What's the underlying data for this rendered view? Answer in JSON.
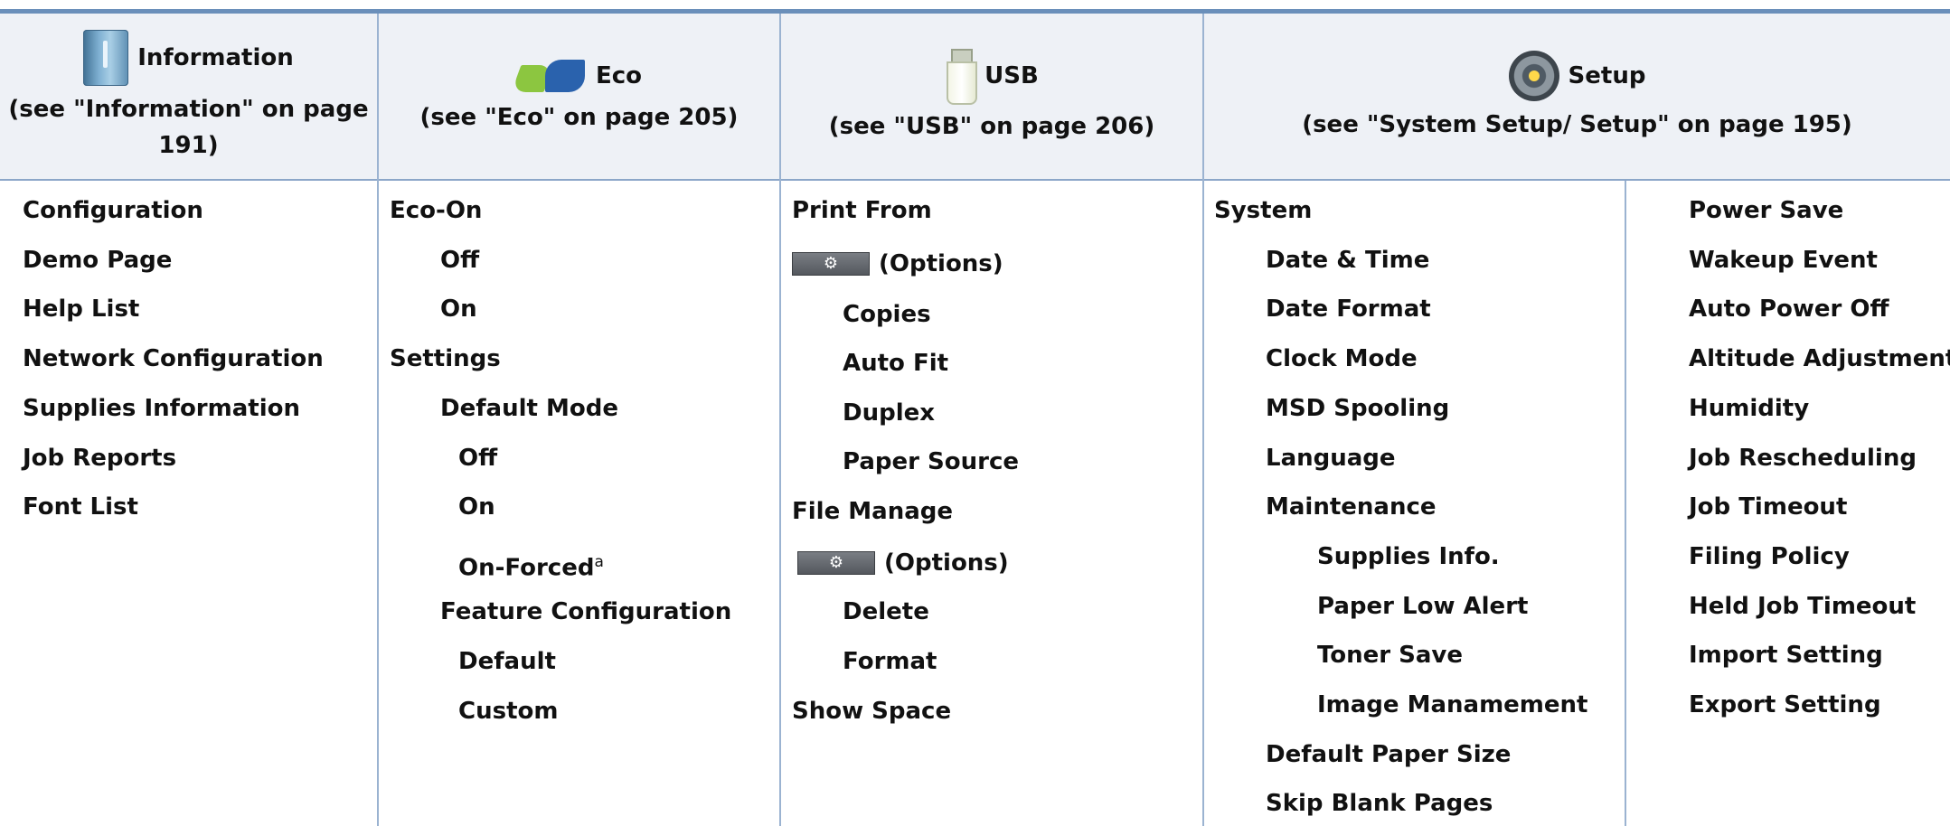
{
  "headers": {
    "information": {
      "title": "Information",
      "ref": "(see \"Information\" on page",
      "ref_page": "191)",
      "icon": "info-book-icon"
    },
    "eco": {
      "title": "Eco",
      "ref": "(see \"Eco\" on page 205)",
      "icon": "eco-leaf-icon"
    },
    "usb": {
      "title": "USB",
      "ref": "(see \"USB\" on page 206)",
      "icon": "usb-drive-icon"
    },
    "setup": {
      "title": "Setup",
      "ref": "(see \"System Setup/ Setup\" on page 195)",
      "icon": "setup-gear-icon"
    }
  },
  "information_items": [
    "Configuration",
    "Demo Page",
    "Help List",
    "Network Configuration",
    "Supplies Information",
    "Job Reports",
    "Font List"
  ],
  "eco_items": {
    "eco_on": "Eco-On",
    "off": "Off",
    "on": "On",
    "settings": "Settings",
    "default_mode": "Default Mode",
    "dm_off": "Off",
    "dm_on": "On",
    "dm_on_forced": "On-Forced",
    "dm_on_forced_note": "a",
    "feature_configuration": "Feature Configuration",
    "fc_default": "Default",
    "fc_custom": "Custom"
  },
  "usb_items": {
    "print_from": "Print From",
    "options_1": "(Options)",
    "copies": "Copies",
    "auto_fit": "Auto Fit",
    "duplex": "Duplex",
    "paper_source": "Paper Source",
    "file_manage": "File Manage",
    "options_2": "(Options)",
    "delete": "Delete",
    "format": "Format",
    "show_space": "Show Space",
    "options_icon": "gear-icon"
  },
  "setup_items_left": {
    "system": "System",
    "date_time": "Date & Time",
    "date_format": "Date Format",
    "clock_mode": "Clock Mode",
    "msd_spooling": "MSD Spooling",
    "language": "Language",
    "maintenance": "Maintenance",
    "supplies_info": "Supplies Info.",
    "paper_low_alert": "Paper Low Alert",
    "toner_save": "Toner Save",
    "image_management": "Image Manamement",
    "default_paper_size": "Default Paper Size",
    "skip_blank_pages": "Skip Blank Pages"
  },
  "setup_items_right": [
    "Power Save",
    "Wakeup Event",
    "Auto Power Off",
    "Altitude Adjustment",
    "Humidity",
    "Job Rescheduling",
    "Job Timeout",
    "Filing Policy",
    "Held Job Timeout",
    "Import Setting",
    "Export Setting"
  ],
  "colors": {
    "accent": "#6a8fba",
    "header_bg": "#eef1f6",
    "rule": "#9bb3d1"
  }
}
